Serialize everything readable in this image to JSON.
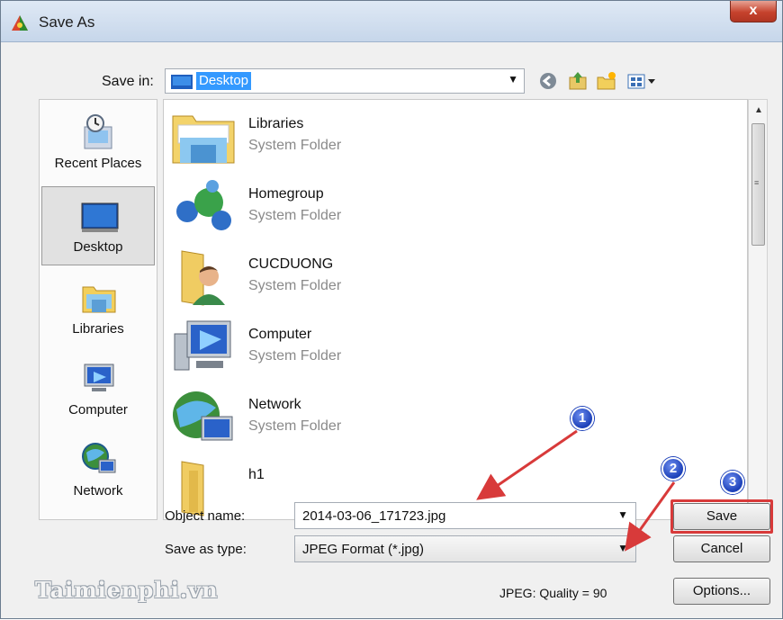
{
  "window": {
    "title": "Save As",
    "close_label": "x"
  },
  "save_in": {
    "label": "Save in:",
    "value": "Desktop"
  },
  "places": [
    {
      "label": "Recent Places",
      "icon": "recent-places-icon"
    },
    {
      "label": "Desktop",
      "icon": "desktop-icon",
      "selected": true
    },
    {
      "label": "Libraries",
      "icon": "libraries-icon"
    },
    {
      "label": "Computer",
      "icon": "computer-icon"
    },
    {
      "label": "Network",
      "icon": "network-icon"
    }
  ],
  "files": [
    {
      "name": "Libraries",
      "type": "System Folder",
      "icon": "libraries-folder-icon"
    },
    {
      "name": "Homegroup",
      "type": "System Folder",
      "icon": "homegroup-icon"
    },
    {
      "name": "CUCDUONG",
      "type": "System Folder",
      "icon": "user-folder-icon"
    },
    {
      "name": "Computer",
      "type": "System Folder",
      "icon": "computer-icon"
    },
    {
      "name": "Network",
      "type": "System Folder",
      "icon": "network-icon"
    },
    {
      "name": "h1",
      "type": "",
      "icon": "folder-icon"
    }
  ],
  "object_name": {
    "label": "Object name:",
    "value": "2014-03-06_171723.jpg"
  },
  "save_as_type": {
    "label": "Save as type:",
    "value": "JPEG Format (*.jpg)"
  },
  "buttons": {
    "save": "Save",
    "cancel": "Cancel",
    "options": "Options..."
  },
  "quality_text": "JPEG: Quality = 90",
  "annotations": [
    "1",
    "2",
    "3"
  ],
  "watermark": "Taimienphi.vn",
  "colors": {
    "highlight": "#d83a3a",
    "badge": "#1b3fb8",
    "selection": "#3399ff"
  }
}
